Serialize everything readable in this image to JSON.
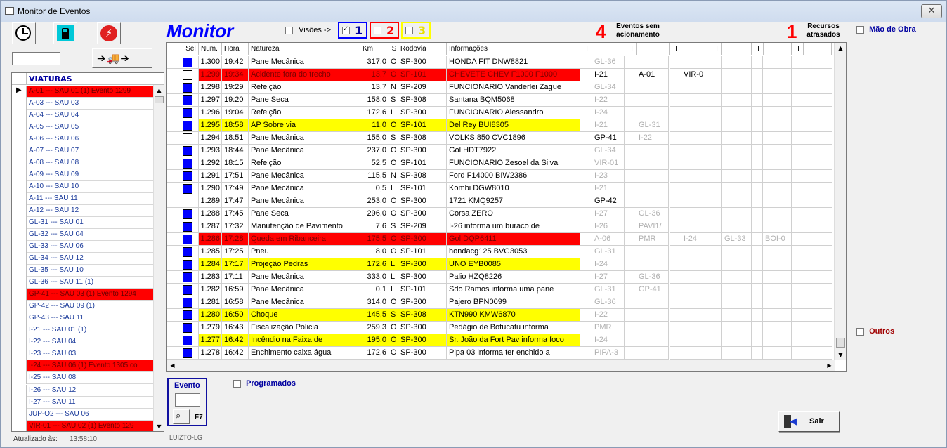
{
  "window": {
    "title": "Monitor de Eventos",
    "close": "✕"
  },
  "header": {
    "title": "Monitor",
    "visoes_label": "Visões ->",
    "visoes": [
      {
        "num": "1",
        "color": "#0000ff",
        "checked": true
      },
      {
        "num": "2",
        "color": "#ff0000",
        "checked": false
      },
      {
        "num": "3",
        "color": "#ffff00",
        "checked": false
      }
    ],
    "eventos_sem_count": "4",
    "eventos_sem_label_1": "Eventos sem",
    "eventos_sem_label_2": "acionamento",
    "recursos_count": "1",
    "recursos_label_1": "Recursos",
    "recursos_label_2": "atrasados",
    "mao_de_obra": "Mão de Obra",
    "outros": "Outros"
  },
  "sidebar": {
    "header": "VIATURAS",
    "items": [
      {
        "text": "A-01 --- SAU 01  (1)     Evento 1299",
        "red": true,
        "current": true
      },
      {
        "text": "A-03 --- SAU 03",
        "red": false
      },
      {
        "text": "A-04 --- SAU 04",
        "red": false
      },
      {
        "text": "A-05 --- SAU 05",
        "red": false
      },
      {
        "text": "A-06 --- SAU 06",
        "red": false
      },
      {
        "text": "A-07 --- SAU 07",
        "red": false
      },
      {
        "text": "A-08 --- SAU 08",
        "red": false
      },
      {
        "text": "A-09 --- SAU 09",
        "red": false
      },
      {
        "text": "A-10 --- SAU 10",
        "red": false
      },
      {
        "text": "A-11 --- SAU 11",
        "red": false
      },
      {
        "text": "A-12 --- SAU 12",
        "red": false
      },
      {
        "text": "GL-31 --- SAU 01",
        "red": false
      },
      {
        "text": "GL-32 --- SAU 04",
        "red": false
      },
      {
        "text": "GL-33 --- SAU 06",
        "red": false
      },
      {
        "text": "GL-34 --- SAU 12",
        "red": false
      },
      {
        "text": "GL-35 --- SAU 10",
        "red": false
      },
      {
        "text": "GL-36 --- SAU 11  (1)",
        "red": false
      },
      {
        "text": "GP-41 --- SAU 03  (1)     Evento 1294",
        "red": true
      },
      {
        "text": "GP-42 --- SAU 09  (1)",
        "red": false
      },
      {
        "text": "GP-43 --- SAU 11",
        "red": false
      },
      {
        "text": "I-21 --- SAU 01  (1)",
        "red": false
      },
      {
        "text": "I-22 --- SAU 04",
        "red": false
      },
      {
        "text": "I-23 --- SAU 03",
        "red": false
      },
      {
        "text": "I-24 --- SAU 06  (1)     Evento 1305 co",
        "red": true
      },
      {
        "text": "I-25 --- SAU 08",
        "red": false
      },
      {
        "text": "I-26 --- SAU 12",
        "red": false
      },
      {
        "text": "I-27 --- SAU 11",
        "red": false
      },
      {
        "text": "JUP-O2 --- SAU 06",
        "red": false
      },
      {
        "text": "VIR-01 --- SAU 02  (1)     Evento 129",
        "red": true
      }
    ],
    "status_label": "Atualizado às:",
    "status_time": "13:58:10"
  },
  "grid": {
    "headers": [
      "Sel",
      "Num.",
      "Hora",
      "Natureza",
      "Km",
      "S",
      "Rodovia",
      "Informações",
      "T",
      "",
      "T",
      "",
      "T",
      "",
      "T",
      "",
      "T",
      "",
      "T",
      ""
    ],
    "rows": [
      {
        "bg": "white",
        "sel": "blue",
        "num": "1.300",
        "hora": "19:42",
        "nat": "Pane Mecânica",
        "km": "317,0",
        "s": "O",
        "rod": "SP-300",
        "info": "HONDA FIT DNW8821",
        "r": [
          [
            "GL-36",
            true
          ]
        ]
      },
      {
        "bg": "red",
        "sel": "white",
        "num": "1.299",
        "hora": "19:34",
        "nat": "Acidente fora do trecho",
        "km": "13,7",
        "s": "O",
        "rod": "SP-101",
        "info": "CHEVETE CHEV F1000 F1000",
        "r": [
          [
            "I-21",
            false
          ],
          [
            "A-01",
            false
          ],
          [
            "VIR-0",
            false
          ]
        ]
      },
      {
        "bg": "white",
        "sel": "blue",
        "num": "1.298",
        "hora": "19:29",
        "nat": "Refeição",
        "km": "13,7",
        "s": "N",
        "rod": "SP-209",
        "info": "FUNCIONARIO Vanderlei Zague",
        "r": [
          [
            "GL-34",
            true
          ]
        ]
      },
      {
        "bg": "white",
        "sel": "blue",
        "num": "1.297",
        "hora": "19:20",
        "nat": "Pane Seca",
        "km": "158,0",
        "s": "S",
        "rod": "SP-308",
        "info": "Santana BQM5068",
        "r": [
          [
            "I-22",
            true
          ]
        ]
      },
      {
        "bg": "white",
        "sel": "blue",
        "num": "1.296",
        "hora": "19:04",
        "nat": "Refeição",
        "km": "172,6",
        "s": "L",
        "rod": "SP-300",
        "info": "FUNCIONARIO Alessandro",
        "r": [
          [
            "I-24",
            true
          ]
        ]
      },
      {
        "bg": "yellow",
        "sel": "blue",
        "num": "1.295",
        "hora": "18:58",
        "nat": "AP Sobre via",
        "km": "11,0",
        "s": "O",
        "rod": "SP-101",
        "info": "Del Rey BUI8305",
        "r": [
          [
            "I-21",
            true
          ],
          [
            "GL-31",
            true
          ]
        ]
      },
      {
        "bg": "white",
        "sel": "white",
        "num": "1.294",
        "hora": "18:51",
        "nat": "Pane Mecânica",
        "km": "155,0",
        "s": "S",
        "rod": "SP-308",
        "info": "VOLKS 850 CVC1896",
        "r": [
          [
            "GP-41",
            false
          ],
          [
            "I-22",
            true
          ]
        ]
      },
      {
        "bg": "white",
        "sel": "blue",
        "num": "1.293",
        "hora": "18:44",
        "nat": "Pane Mecânica",
        "km": "237,0",
        "s": "O",
        "rod": "SP-300",
        "info": "Gol HDT7922",
        "r": [
          [
            "GL-34",
            true
          ]
        ]
      },
      {
        "bg": "white",
        "sel": "blue",
        "num": "1.292",
        "hora": "18:15",
        "nat": "Refeição",
        "km": "52,5",
        "s": "O",
        "rod": "SP-101",
        "info": "FUNCIONARIO Zesoel da Silva",
        "r": [
          [
            "VIR-01",
            true
          ]
        ]
      },
      {
        "bg": "white",
        "sel": "blue",
        "num": "1.291",
        "hora": "17:51",
        "nat": "Pane Mecânica",
        "km": "115,5",
        "s": "N",
        "rod": "SP-308",
        "info": "Ford F14000 BIW2386",
        "r": [
          [
            "I-23",
            true
          ]
        ]
      },
      {
        "bg": "white",
        "sel": "blue",
        "num": "1.290",
        "hora": "17:49",
        "nat": "Pane Mecânica",
        "km": "0,5",
        "s": "L",
        "rod": "SP-101",
        "info": "Kombi DGW8010",
        "r": [
          [
            "I-21",
            true
          ]
        ]
      },
      {
        "bg": "white",
        "sel": "white",
        "num": "1.289",
        "hora": "17:47",
        "nat": "Pane Mecânica",
        "km": "253,0",
        "s": "O",
        "rod": "SP-300",
        "info": "1721 KMQ9257",
        "r": [
          [
            "GP-42",
            false
          ]
        ]
      },
      {
        "bg": "white",
        "sel": "blue",
        "num": "1.288",
        "hora": "17:45",
        "nat": "Pane Seca",
        "km": "296,0",
        "s": "O",
        "rod": "SP-300",
        "info": "Corsa ZERO",
        "r": [
          [
            "I-27",
            true
          ],
          [
            "GL-36",
            true
          ]
        ]
      },
      {
        "bg": "white",
        "sel": "blue",
        "num": "1.287",
        "hora": "17:32",
        "nat": "Manutenção de Pavimento",
        "km": "7,6",
        "s": "S",
        "rod": "SP-209",
        "info": "I-26 informa um buraco de",
        "r": [
          [
            "I-26",
            true
          ],
          [
            "PAVI1/",
            true
          ]
        ]
      },
      {
        "bg": "red",
        "sel": "blue",
        "num": "1.286",
        "hora": "17:28",
        "nat": "Queda em Ribanceira",
        "km": "175,5",
        "s": "O",
        "rod": "SP-300",
        "info": "Gol DQP6411",
        "r": [
          [
            "A-06",
            true
          ],
          [
            "PMR",
            true
          ],
          [
            "I-24",
            true
          ],
          [
            "GL-33",
            true
          ],
          [
            "BOI-0",
            true
          ]
        ]
      },
      {
        "bg": "white",
        "sel": "blue",
        "num": "1.285",
        "hora": "17:25",
        "nat": "Pneu",
        "km": "8,0",
        "s": "O",
        "rod": "SP-101",
        "info": "hondacg125 BVG3053",
        "r": [
          [
            "GL-31",
            true
          ]
        ]
      },
      {
        "bg": "yellow",
        "sel": "blue",
        "num": "1.284",
        "hora": "17:17",
        "nat": "Projeção Pedras",
        "km": "172,6",
        "s": "L",
        "rod": "SP-300",
        "info": "UNO EYB0085",
        "r": [
          [
            "I-24",
            true
          ]
        ]
      },
      {
        "bg": "white",
        "sel": "blue",
        "num": "1.283",
        "hora": "17:11",
        "nat": "Pane Mecânica",
        "km": "333,0",
        "s": "L",
        "rod": "SP-300",
        "info": "Palio HZQ8226",
        "r": [
          [
            "I-27",
            true
          ],
          [
            "GL-36",
            true
          ]
        ]
      },
      {
        "bg": "white",
        "sel": "blue",
        "num": "1.282",
        "hora": "16:59",
        "nat": "Pane Mecânica",
        "km": "0,1",
        "s": "L",
        "rod": "SP-101",
        "info": "Sdo Ramos informa uma pane",
        "r": [
          [
            "GL-31",
            true
          ],
          [
            "GP-41",
            true
          ]
        ]
      },
      {
        "bg": "white",
        "sel": "blue",
        "num": "1.281",
        "hora": "16:58",
        "nat": "Pane Mecânica",
        "km": "314,0",
        "s": "O",
        "rod": "SP-300",
        "info": "Pajero BPN0099",
        "r": [
          [
            "GL-36",
            true
          ]
        ]
      },
      {
        "bg": "yellow",
        "sel": "blue",
        "num": "1.280",
        "hora": "16:50",
        "nat": "Choque",
        "km": "145,5",
        "s": "S",
        "rod": "SP-308",
        "info": "KTN990 KMW6870",
        "r": [
          [
            "I-22",
            true
          ]
        ]
      },
      {
        "bg": "white",
        "sel": "blue",
        "num": "1.279",
        "hora": "16:43",
        "nat": "Fiscalização Policia",
        "km": "259,3",
        "s": "O",
        "rod": "SP-300",
        "info": "Pedágio de Botucatu informa",
        "r": [
          [
            "PMR",
            true
          ]
        ]
      },
      {
        "bg": "yellow",
        "sel": "blue",
        "num": "1.277",
        "hora": "16:42",
        "nat": "Incêndio na Faixa de",
        "km": "195,0",
        "s": "O",
        "rod": "SP-300",
        "info": "Sr. João da Fort Pav informa foco",
        "r": [
          [
            "I-24",
            true
          ]
        ]
      },
      {
        "bg": "white",
        "sel": "blue",
        "num": "1.278",
        "hora": "16:42",
        "nat": "Enchimento caixa água",
        "km": "172,6",
        "s": "O",
        "rod": "SP-300",
        "info": "Pipa 03 informa ter enchido a",
        "r": [
          [
            "PIPA-3",
            true
          ]
        ]
      }
    ]
  },
  "footer": {
    "evento_label": "Evento",
    "f7": "F7",
    "programados": "Programados",
    "user": "LUIZTO-LG",
    "sair": "Sair"
  }
}
